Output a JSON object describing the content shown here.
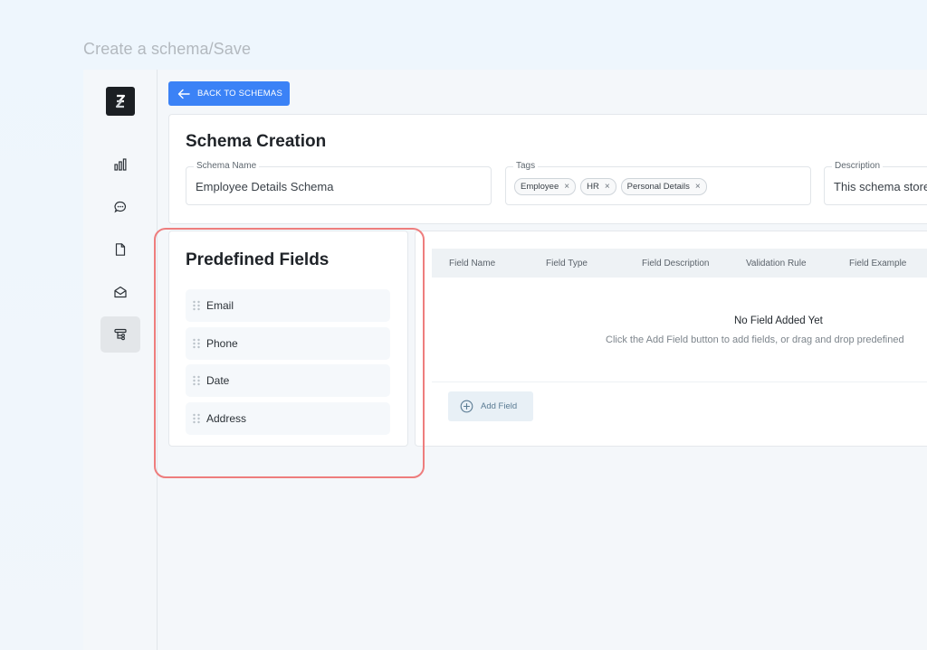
{
  "caption": "Create a schema/Save",
  "sidebar": {
    "logo": "app-logo",
    "items": [
      {
        "name": "analytics",
        "icon": "bar-chart-icon",
        "active": false
      },
      {
        "name": "chat",
        "icon": "chat-icon",
        "active": false
      },
      {
        "name": "documents",
        "icon": "document-icon",
        "active": false
      },
      {
        "name": "inbox",
        "icon": "mail-open-icon",
        "active": false
      },
      {
        "name": "schemas",
        "icon": "schema-icon",
        "active": true
      }
    ]
  },
  "back_button": {
    "label": "BACK TO SCHEMAS",
    "icon": "arrow-left-icon"
  },
  "schema_creation": {
    "title": "Schema Creation",
    "schema_name": {
      "label": "Schema Name",
      "value": "Employee Details Schema"
    },
    "tags": {
      "label": "Tags",
      "items": [
        "Employee",
        "HR",
        "Personal Details"
      ],
      "remove_glyph": "×"
    },
    "description": {
      "label": "Description",
      "value": "This schema store"
    }
  },
  "predefined_fields": {
    "title": "Predefined Fields",
    "items": [
      "Email",
      "Phone",
      "Date",
      "Address"
    ]
  },
  "fields_table": {
    "columns": [
      "Field Name",
      "Field Type",
      "Field Description",
      "Validation Rule",
      "Field Example"
    ],
    "empty_title": "No Field Added Yet",
    "empty_subtitle": "Click the Add Field button to add fields, or drag and drop predefined",
    "add_button": "Add Field"
  },
  "colors": {
    "accent": "#3b82f6",
    "highlight": "#ee7d7d"
  }
}
